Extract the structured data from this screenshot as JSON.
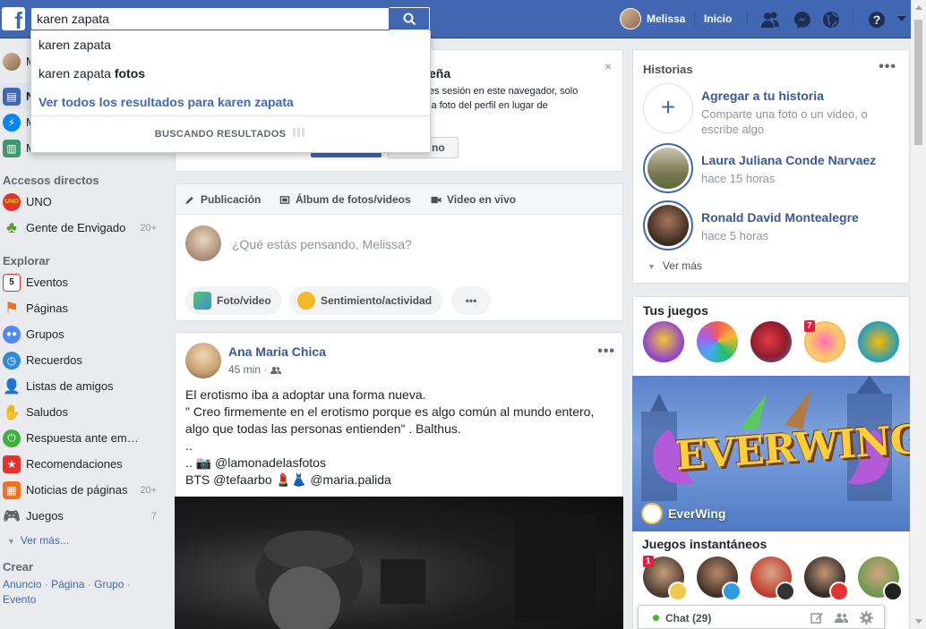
{
  "topbar": {
    "logo": "f",
    "search_value": "karen zapata",
    "user_name": "Melissa",
    "home_label": "Inicio",
    "icons": [
      "friends-icon",
      "messenger-icon",
      "globe-icon",
      "help-icon",
      "caret-down-icon"
    ]
  },
  "search_dropdown": {
    "suggestion_1": "karen zapata",
    "suggestion_2_prefix": "karen zapata ",
    "suggestion_2_bold": "fotos",
    "see_all": "Ver todos los resultados para karen zapata",
    "status": "BUSCANDO RESULTADOS"
  },
  "left_nav": {
    "top_items": [
      {
        "label": "M",
        "icon": "profile-avatar"
      },
      {
        "label": "N",
        "icon": "news-feed-icon"
      },
      {
        "label": "M",
        "icon": "messenger-icon"
      },
      {
        "label": "M",
        "icon": "marketplace-icon"
      }
    ],
    "shortcuts_header": "Accesos directos",
    "shortcuts": [
      {
        "label": "UNO",
        "count": ""
      },
      {
        "label": "Gente de Envigado",
        "count": "20+"
      }
    ],
    "explore_header": "Explorar",
    "explore": [
      {
        "label": "Eventos",
        "count": ""
      },
      {
        "label": "Páginas",
        "count": ""
      },
      {
        "label": "Grupos",
        "count": ""
      },
      {
        "label": "Recuerdos",
        "count": ""
      },
      {
        "label": "Listas de amigos",
        "count": ""
      },
      {
        "label": "Saludos",
        "count": ""
      },
      {
        "label": "Respuesta ante em…",
        "count": ""
      },
      {
        "label": "Recomendaciones",
        "count": ""
      },
      {
        "label": "Noticias de páginas",
        "count": "20+"
      },
      {
        "label": "Juegos",
        "count": "7"
      }
    ],
    "see_more": "Ver más...",
    "create_header": "Crear",
    "create_links": [
      "Anuncio",
      "Página",
      "Grupo",
      "Evento"
    ]
  },
  "notice_card": {
    "title_partial": "eña",
    "text_line_1": "es sesión en este navegador, solo",
    "text_line_2": "la foto del perfil en lugar de",
    "secondary_button": "no",
    "close": "×"
  },
  "composer": {
    "tab_post": "Publicación",
    "tab_album": "Álbum de fotos/videos",
    "tab_live": "Video en vivo",
    "placeholder": "¿Qué estás pensando, Melissa?",
    "action_photo": "Foto/video",
    "action_feeling": "Sentimiento/actividad",
    "action_more": "•••"
  },
  "post": {
    "author": "Ana Maria Chica",
    "time": "45 min · ",
    "more": "•••",
    "lines": [
      "El erotismo iba a adoptar una forma nueva.",
      "\" Creo firmemente en el erotismo porque es algo común al mundo entero,",
      "algo que todas las personas entienden\" . Balthus.",
      "..",
      ".. 📷 @lamonadelasfotos",
      "BTS @tefaarbo 💄👗 @maria.palida"
    ]
  },
  "stories": {
    "title": "Historias",
    "more": "•••",
    "add_title": "Agregar a tu historia",
    "add_sub": "Comparte una foto o un video, o escribe algo",
    "items": [
      {
        "name": "Laura Juliana Conde Narvaez",
        "time": "hace 15 horas"
      },
      {
        "name": "Ronald David Montealegre",
        "time": "hace 5 horas"
      }
    ],
    "see_more": "Ver más"
  },
  "games": {
    "title": "Tus juegos",
    "badge": "7",
    "banner_logo": "EVERWING",
    "banner_name": "EverWing",
    "instant_title": "Juegos instantáneos",
    "instant_badge": "1"
  },
  "chat": {
    "label": "Chat (29)"
  }
}
